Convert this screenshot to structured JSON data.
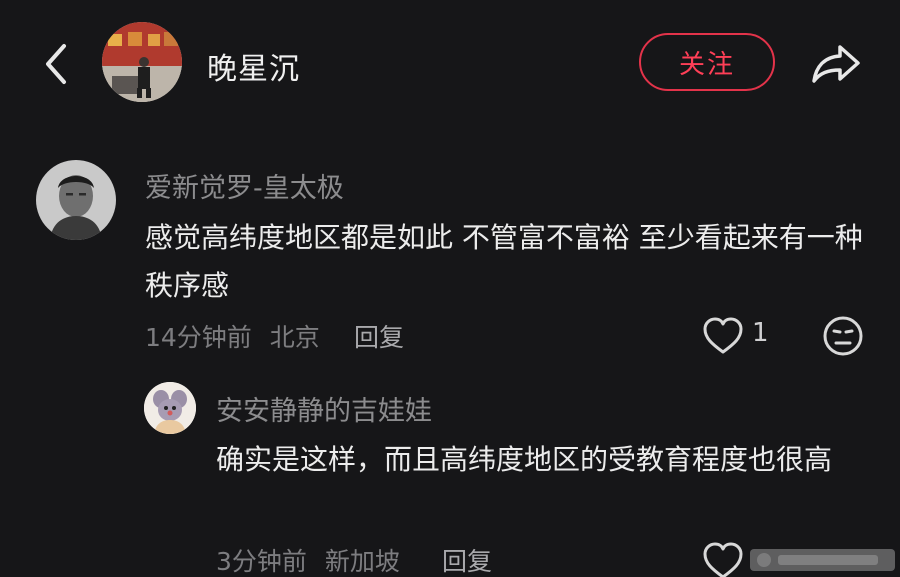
{
  "header": {
    "back_icon": "chevron-left-icon",
    "author_name": "晚星沉",
    "follow_label": "关注",
    "share_icon": "share-arrow-icon",
    "accent_color": "#e3334a"
  },
  "comment": {
    "username": "爱新觉罗-皇太极",
    "text": "感觉高纬度地区都是如此 不管富不富裕 至少看起来有一种秩序感",
    "time": "14分钟前",
    "location": "北京",
    "reply_label": "回复",
    "like_icon": "heart-icon",
    "like_count": "1",
    "dislike_icon": "neutral-face-icon"
  },
  "reply": {
    "username": "安安静静的吉娃娃",
    "text": "确实是这样，而且高纬度地区的受教育程度也很高",
    "time": "3分钟前",
    "location": "新加坡",
    "reply_label": "回复",
    "like_icon": "heart-icon"
  }
}
